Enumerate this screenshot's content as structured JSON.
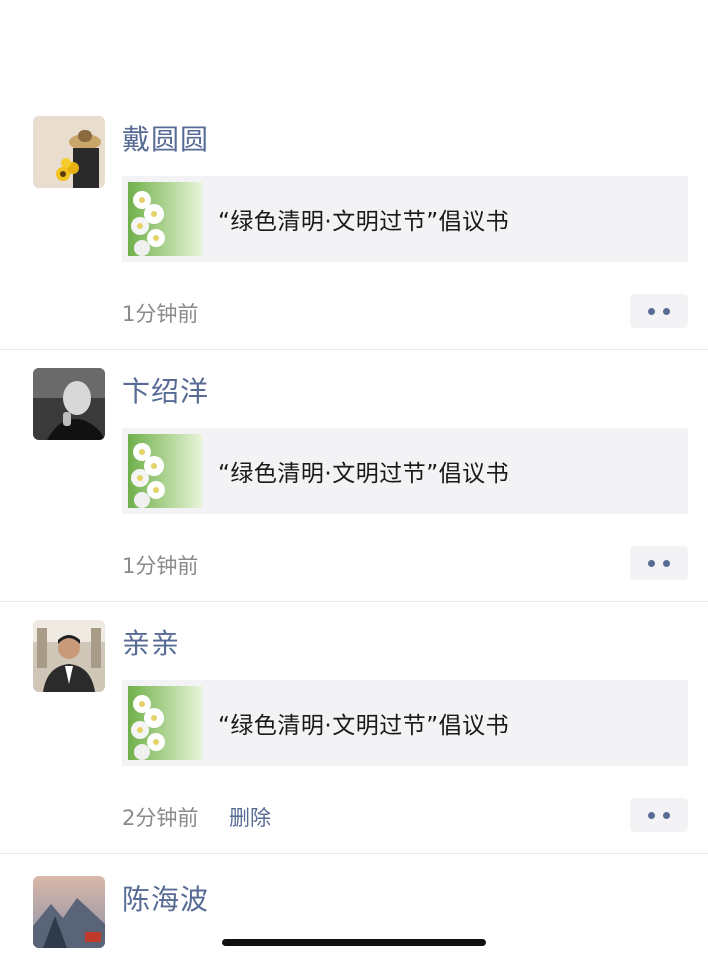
{
  "feed": {
    "posts": [
      {
        "author": "戴圆圆",
        "avatar_icon": "avatar-woman-hat-sunflowers",
        "share_title": "“绿色清明·文明过节”倡议书",
        "time": "1分钟前",
        "delete_label": ""
      },
      {
        "author": "卞绍洋",
        "avatar_icon": "avatar-man-bw-portrait",
        "share_title": "“绿色清明·文明过节”倡议书",
        "time": "1分钟前",
        "delete_label": ""
      },
      {
        "author": "亲亲",
        "avatar_icon": "avatar-man-suit",
        "share_title": "“绿色清明·文明过节”倡议书",
        "time": "2分钟前",
        "delete_label": "删除"
      },
      {
        "author": "陈海波",
        "avatar_icon": "avatar-landscape"
      }
    ]
  },
  "colors": {
    "link_blue": "#576b95",
    "card_bg": "#f3f3f5",
    "time_gray": "#8a8a8a"
  }
}
